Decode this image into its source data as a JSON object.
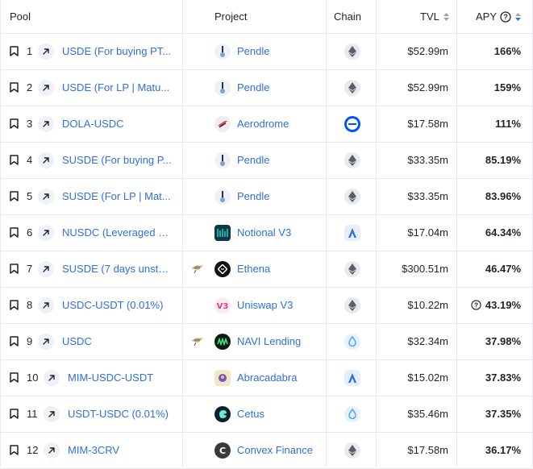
{
  "header": {
    "pool": "Pool",
    "project": "Project",
    "chain": "Chain",
    "tvl": "TVL",
    "apy": "APY"
  },
  "rows": [
    {
      "rank": "1",
      "pool": "USDE (For buying PT...",
      "project": "Pendle",
      "project_logo": "pendle-logo",
      "chain": "ethereum",
      "tvl": "$52.99m",
      "apy": "166%",
      "bird": false,
      "apy_info": false
    },
    {
      "rank": "2",
      "pool": "USDE (For LP | Matu...",
      "project": "Pendle",
      "project_logo": "pendle-logo",
      "chain": "ethereum",
      "tvl": "$52.99m",
      "apy": "159%",
      "bird": false,
      "apy_info": false
    },
    {
      "rank": "3",
      "pool": "DOLA-USDC",
      "project": "Aerodrome",
      "project_logo": "aerodrome-logo",
      "chain": "base",
      "tvl": "$17.58m",
      "apy": "111%",
      "bird": false,
      "apy_info": false
    },
    {
      "rank": "4",
      "pool": "SUSDE (For buying P...",
      "project": "Pendle",
      "project_logo": "pendle-logo",
      "chain": "ethereum",
      "tvl": "$33.35m",
      "apy": "85.19%",
      "bird": false,
      "apy_info": false
    },
    {
      "rank": "5",
      "pool": "SUSDE (For LP | Mat...",
      "project": "Pendle",
      "project_logo": "pendle-logo",
      "chain": "ethereum",
      "tvl": "$33.35m",
      "apy": "83.96%",
      "bird": false,
      "apy_info": false
    },
    {
      "rank": "6",
      "pool": "NUSDC (Leveraged Li...",
      "project": "Notional V3",
      "project_logo": "notional-logo",
      "chain": "arbitrum",
      "tvl": "$17.04m",
      "apy": "64.34%",
      "bird": false,
      "apy_info": false
    },
    {
      "rank": "7",
      "pool": "SUSDE (7 days unsta...",
      "project": "Ethena",
      "project_logo": "ethena-logo",
      "chain": "ethereum",
      "tvl": "$300.51m",
      "apy": "46.47%",
      "bird": true,
      "apy_info": false
    },
    {
      "rank": "8",
      "pool": "USDC-USDT (0.01%)",
      "project": "Uniswap V3",
      "project_logo": "uniswap-logo",
      "chain": "ethereum",
      "tvl": "$10.22m",
      "apy": "43.19%",
      "bird": false,
      "apy_info": true
    },
    {
      "rank": "9",
      "pool": "USDC",
      "project": "NAVI Lending",
      "project_logo": "navi-logo",
      "chain": "sui",
      "tvl": "$32.34m",
      "apy": "37.98%",
      "bird": true,
      "apy_info": false
    },
    {
      "rank": "10",
      "pool": "MIM-USDC-USDT",
      "project": "Abracadabra",
      "project_logo": "abracadabra-logo",
      "chain": "arbitrum",
      "tvl": "$15.02m",
      "apy": "37.83%",
      "bird": false,
      "apy_info": false
    },
    {
      "rank": "11",
      "pool": "USDT-USDC (0.01%)",
      "project": "Cetus",
      "project_logo": "cetus-logo",
      "chain": "sui",
      "tvl": "$35.46m",
      "apy": "37.35%",
      "bird": false,
      "apy_info": false
    },
    {
      "rank": "12",
      "pool": "MIM-3CRV",
      "project": "Convex Finance",
      "project_logo": "convex-logo",
      "chain": "ethereum",
      "tvl": "$17.58m",
      "apy": "36.17%",
      "bird": false,
      "apy_info": false
    }
  ],
  "colors": {
    "link": "#2f6fde",
    "border": "#e7e9ee",
    "sort_active": "#2f6fde",
    "sort_inactive": "#9aa1ad"
  }
}
